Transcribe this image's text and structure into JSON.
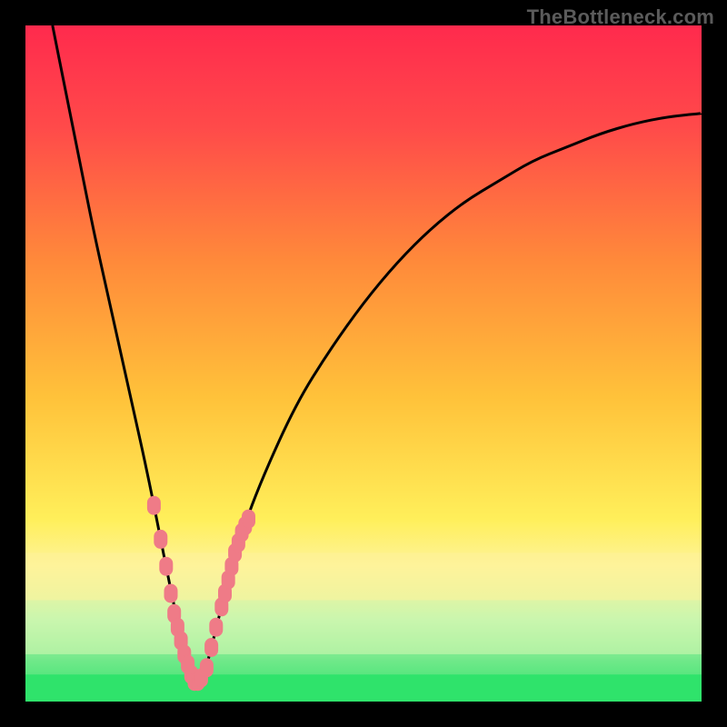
{
  "watermark": "TheBottleneck.com",
  "colors": {
    "frame": "#000000",
    "curve": "#000000",
    "marker_fill": "#ef7b87",
    "marker_stroke": "#ef7b87",
    "green_band": "#2fe36b",
    "green_band_light": "#c9f6ae",
    "yellow_band": "#fef39a"
  },
  "chart_data": {
    "type": "line",
    "title": "",
    "xlabel": "",
    "ylabel": "",
    "xlim": [
      0,
      100
    ],
    "ylim": [
      0,
      100
    ],
    "grid": false,
    "legend": false,
    "optimum_x": 25,
    "gradient_stops": [
      {
        "offset": 0.0,
        "color": "#ff2a4d"
      },
      {
        "offset": 0.15,
        "color": "#ff4a4a"
      },
      {
        "offset": 0.35,
        "color": "#ff8a3a"
      },
      {
        "offset": 0.55,
        "color": "#ffc23a"
      },
      {
        "offset": 0.73,
        "color": "#ffef5a"
      },
      {
        "offset": 0.8,
        "color": "#fef39a"
      },
      {
        "offset": 0.88,
        "color": "#c9f6ae"
      },
      {
        "offset": 0.94,
        "color": "#6fe889"
      },
      {
        "offset": 1.0,
        "color": "#2fe36b"
      }
    ],
    "series": [
      {
        "name": "bottleneck-curve",
        "x": [
          4,
          6,
          8,
          10,
          12,
          14,
          16,
          18,
          20,
          21,
          22,
          23,
          24,
          25,
          26,
          27,
          28,
          29,
          30,
          32,
          35,
          40,
          45,
          50,
          55,
          60,
          65,
          70,
          75,
          80,
          85,
          90,
          95,
          100
        ],
        "y": [
          100,
          90,
          80,
          70,
          61,
          52,
          43,
          34,
          24,
          19,
          14,
          10,
          6,
          3,
          3,
          6,
          10,
          14,
          18,
          25,
          33,
          44,
          52,
          59,
          65,
          70,
          74,
          77,
          80,
          82,
          84,
          85.5,
          86.5,
          87
        ]
      }
    ],
    "markers": {
      "name": "sample-points",
      "x": [
        19,
        20,
        20.8,
        21.5,
        22,
        22.5,
        23,
        23.5,
        24,
        24.5,
        25,
        25.5,
        26,
        26.8,
        27.5,
        28.2,
        29,
        29.5,
        30,
        30.5,
        31,
        31.5,
        32,
        32.5,
        33
      ],
      "y": [
        29,
        24,
        20,
        16,
        13,
        11,
        9,
        7,
        5.5,
        4,
        3,
        3,
        3.5,
        5,
        8,
        11,
        14,
        16,
        18,
        20,
        22,
        23.5,
        25,
        26,
        27
      ]
    }
  }
}
